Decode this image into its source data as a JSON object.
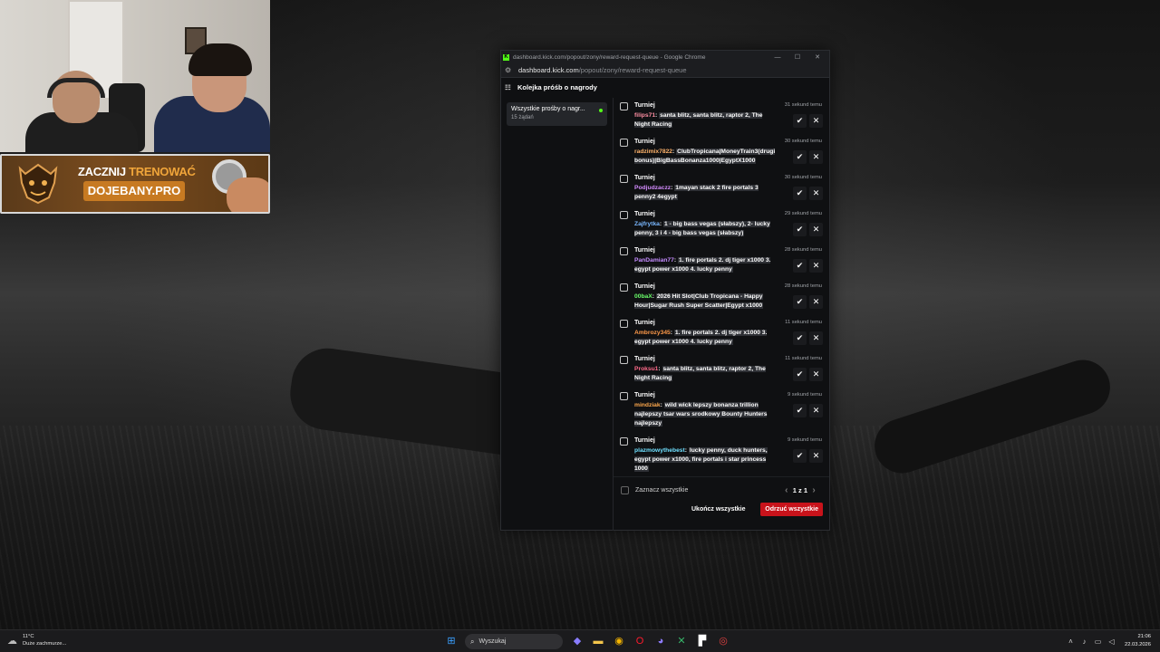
{
  "webcam": {
    "banner": {
      "cta_part1": "ZACZNIJ",
      "cta_part2": "TRENOWAĆ",
      "url": "DOJEBANY.PRO"
    }
  },
  "window": {
    "title": "dashboard.kick.com/popout/zony/reward-request-queue - Google Chrome",
    "address_host": "dashboard.kick.com",
    "address_path": "/popout/zony/reward-request-queue",
    "controls": {
      "minimize": "—",
      "maximize": "☐",
      "close": "✕"
    }
  },
  "page": {
    "header": "Kolejka próśb o nagrody",
    "filter": {
      "name": "Wszystkie prośby o nagr...",
      "count": "15 żądań",
      "dot_color": "#53fc18"
    },
    "requests": [
      {
        "reward": "Turniej",
        "time": "31 sekund temu",
        "user": "filips71",
        "user_color": "#ff8fa3",
        "text": "santa blitz, santa blitz, raptor 2, The Night Racing"
      },
      {
        "reward": "Turniej",
        "time": "30 sekund temu",
        "user": "radzimix7822",
        "user_color": "#ffb36b",
        "text": "ClubTropicana|MoneyTrain3(drugi bonus)|BigBassBonanza1000|EgyptX1000"
      },
      {
        "reward": "Turniej",
        "time": "30 sekund temu",
        "user": "Podjudzaczz",
        "user_color": "#d48cff",
        "text": "1mayan stack 2 fire portals 3 penny2 4egypt"
      },
      {
        "reward": "Turniej",
        "time": "29 sekund temu",
        "user": "Zajfrytka",
        "user_color": "#7ab8ff",
        "text": "1 - big bass vegas (słabszy), 2- lucky penny, 3 i 4 - big bass vegas (słabszy)"
      },
      {
        "reward": "Turniej",
        "time": "28 sekund temu",
        "user": "PanDamian77",
        "user_color": "#c58cff",
        "text": "1. fire portals 2. dj tiger x1000 3. egypt power x1000 4. lucky penny"
      },
      {
        "reward": "Turniej",
        "time": "28 sekund temu",
        "user": "00baX",
        "user_color": "#6bff6b",
        "text": "2026 Hit Slot|Club Tropicana - Happy Hour|Sugar Rush Super Scatter|Egypt x1000"
      },
      {
        "reward": "Turniej",
        "time": "11 sekund temu",
        "user": "Ambrozy345",
        "user_color": "#ff9a4a",
        "text": "1. fire portals 2. dj tiger x1000 3. egypt power x1000 4. lucky penny"
      },
      {
        "reward": "Turniej",
        "time": "11 sekund temu",
        "user": "Proksu1",
        "user_color": "#ff6b8a",
        "text": "santa blitz, santa blitz, raptor 2, The Night Racing"
      },
      {
        "reward": "Turniej",
        "time": "9 sekund temu",
        "user": "mindziak",
        "user_color": "#ffa94d",
        "text": "wild wick lepszy bonanza trillion najlepszy tsar wars srodkowy Bounty Hunters najlepszy"
      },
      {
        "reward": "Turniej",
        "time": "9 sekund temu",
        "user": "plazmowythebest",
        "user_color": "#6fe0ff",
        "text": "lucky penny, duck hunters, egypt power x1000, fire portals i star princess 1000"
      }
    ],
    "footer": {
      "select_all": "Zaznacz wszystkie",
      "pager": "1 z 1",
      "finish_all": "Ukończ wszystkie",
      "reject_all": "Odrzuć wszystkie"
    }
  },
  "taskbar": {
    "weather_temp": "11°C",
    "weather_desc": "Duże zachmurze...",
    "search_placeholder": "Wyszukaj",
    "time": "21:06",
    "date": "22.03.2026"
  }
}
